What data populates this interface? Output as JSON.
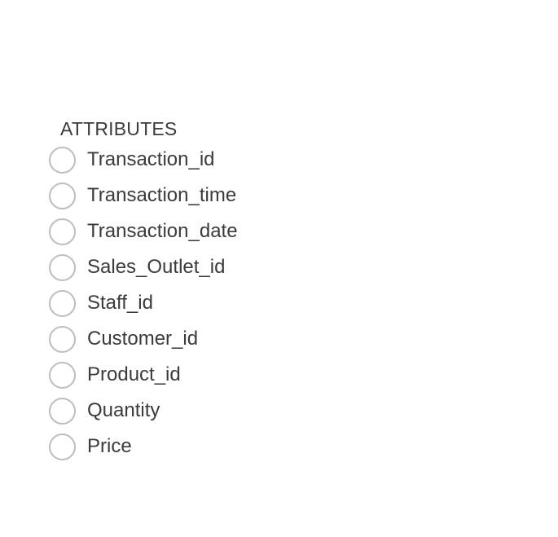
{
  "attributes": {
    "title": "ATTRIBUTES",
    "items": [
      {
        "label": "Transaction_id",
        "selected": false
      },
      {
        "label": "Transaction_time",
        "selected": false
      },
      {
        "label": "Transaction_date",
        "selected": false
      },
      {
        "label": "Sales_Outlet_id",
        "selected": false
      },
      {
        "label": "Staff_id",
        "selected": false
      },
      {
        "label": "Customer_id",
        "selected": false
      },
      {
        "label": "Product_id",
        "selected": false
      },
      {
        "label": "Quantity",
        "selected": false
      },
      {
        "label": "Price",
        "selected": false
      }
    ]
  },
  "colors": {
    "text": "#3b3b3b",
    "radio_border": "#bdbdbd",
    "background": "#ffffff"
  }
}
